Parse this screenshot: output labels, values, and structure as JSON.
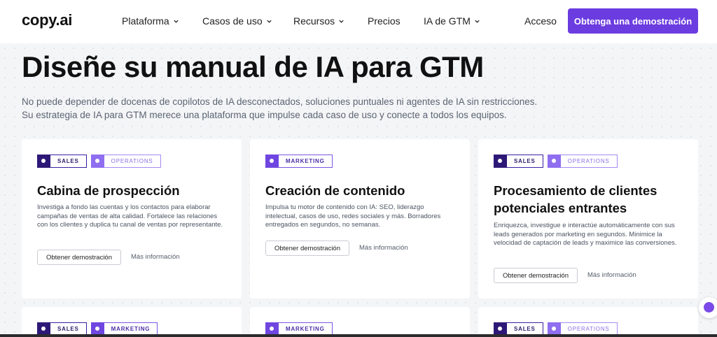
{
  "nav": {
    "logo": "copy.ai",
    "items": [
      {
        "label": "Plataforma",
        "has_chevron": true
      },
      {
        "label": "Casos de uso",
        "has_chevron": true
      },
      {
        "label": "Recursos",
        "has_chevron": true
      },
      {
        "label": "Precios",
        "has_chevron": false
      },
      {
        "label": "IA de GTM",
        "has_chevron": true
      }
    ],
    "login": "Acceso",
    "cta": "Obtenga una demostración"
  },
  "hero": {
    "title": "Diseñe su manual de IA para GTM",
    "subtitle_line1": "No puede depender de docenas de copilotos de IA desconectados, soluciones puntuales ni agentes de IA sin restricciones.",
    "subtitle_line2": "Su estrategia de IA para GTM merece una plataforma que impulse cada caso de uso y conecte a todos los equipos."
  },
  "cards": [
    {
      "tags": [
        "SALES",
        "OPERATIONS"
      ],
      "title": "Cabina de prospección",
      "description": "Investiga a fondo las cuentas y los contactos para elaborar campañas de ventas de alta calidad. Fortalece las relaciones con los clientes y duplica tu canal de ventas por representante.",
      "demo_label": "Obtener demostración",
      "more_label": "Más información"
    },
    {
      "tags": [
        "MARKETING"
      ],
      "title": "Creación de contenido",
      "description": "Impulsa tu motor de contenido con IA: SEO, liderazgo intelectual, casos de uso, redes sociales y más. Borradores entregados en segundos, no semanas.",
      "demo_label": "Obtener demostración",
      "more_label": "Más información"
    },
    {
      "tags": [
        "SALES",
        "OPERATIONS"
      ],
      "title": "Procesamiento de clientes potenciales entrantes",
      "description": "Enriquezca, investigue e interactúe automáticamente con sus leads generados por marketing en segundos. Minimice la velocidad de captación de leads y maximice las conversiones.",
      "demo_label": "Obtener demostración",
      "more_label": "Más información"
    },
    {
      "tags": [
        "SALES",
        "MARKETING"
      ]
    },
    {
      "tags": [
        "MARKETING"
      ]
    },
    {
      "tags": [
        "SALES",
        "OPERATIONS"
      ]
    }
  ],
  "colors": {
    "accent": "#6b3ce0",
    "tag_dark": "#2e1877",
    "tag_light": "#8f6ef0"
  }
}
